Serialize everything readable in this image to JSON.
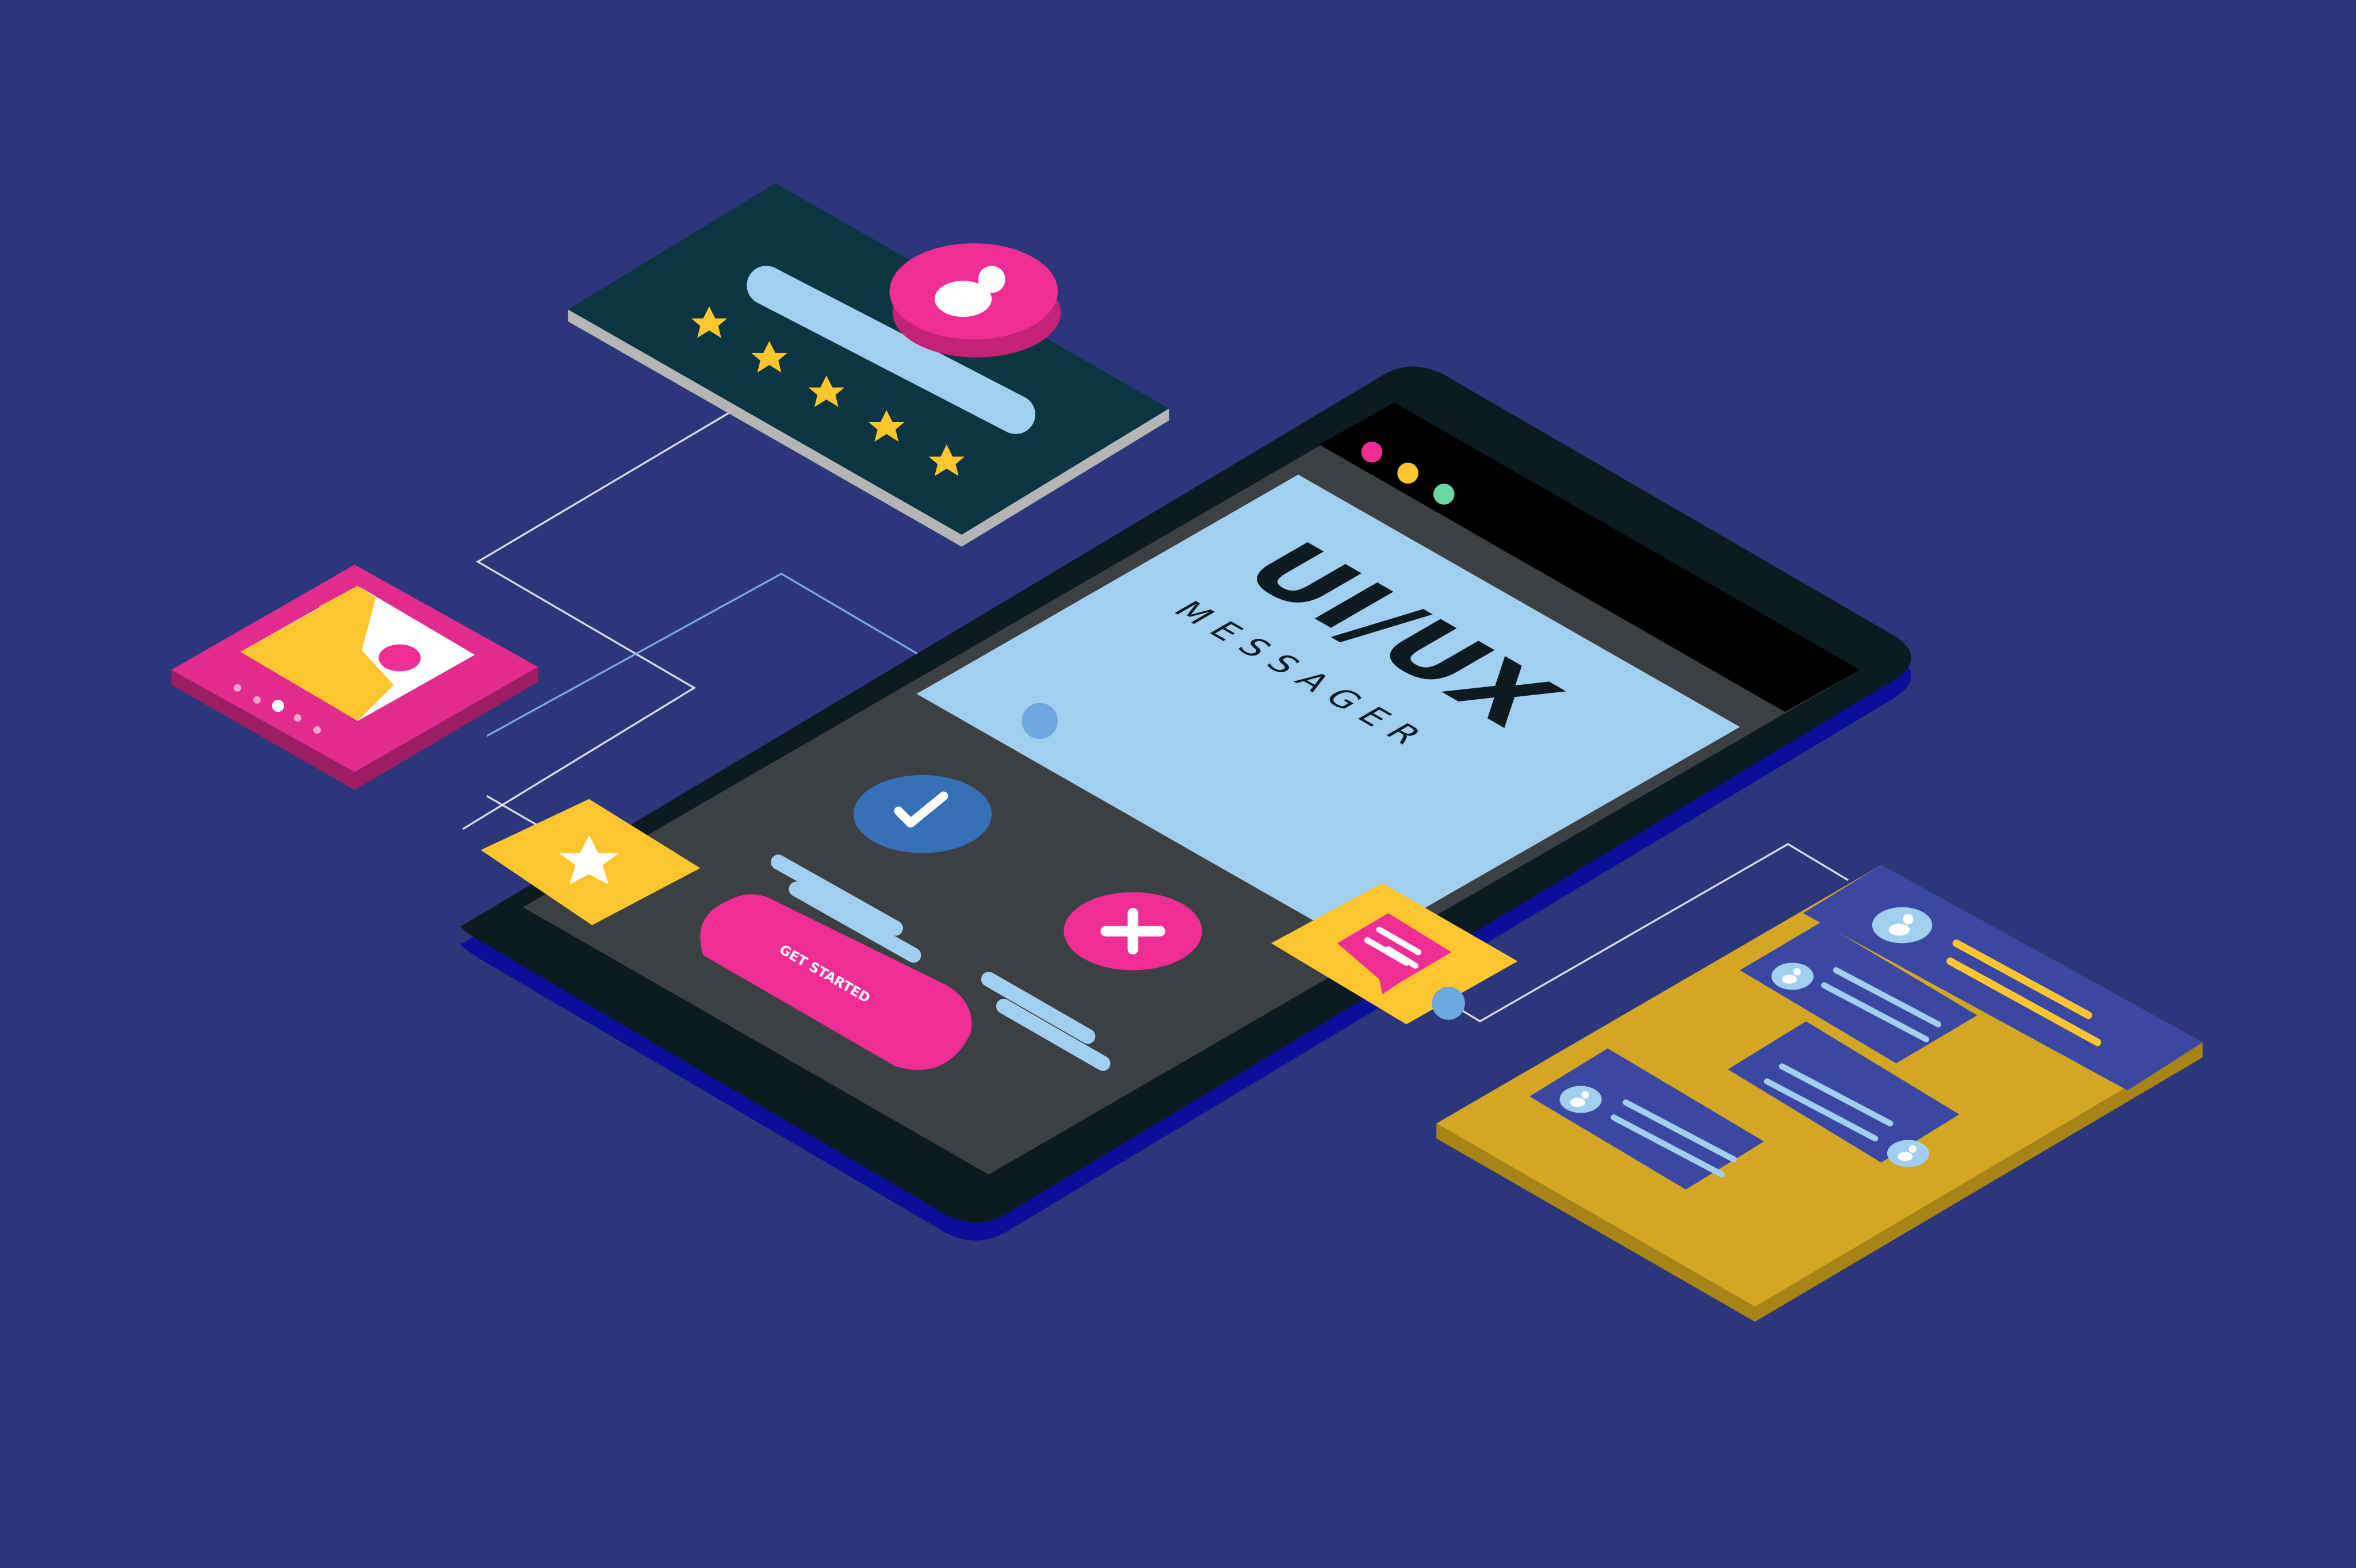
{
  "screen": {
    "title": "UI/UX",
    "subtitle": "MESSAGER"
  },
  "buttons": {
    "get_started": "GET STARTED"
  },
  "rating_card": {
    "stars": 5
  },
  "window_controls": {
    "dots": [
      "red",
      "yellow",
      "green"
    ]
  },
  "colors": {
    "background": "#2b377a",
    "phone_body": "#0c1b22",
    "phone_screen": "#3c4043",
    "screen_panel": "#a2cff0",
    "accent_pink": "#ee2e94",
    "accent_yellow": "#fdc62e",
    "accent_blue": "#3670b7",
    "card_dark": "#0b3540",
    "card_gold": "#d3a724",
    "card_indigo": "#3a48a3",
    "line_light": "#a2cff0"
  },
  "icons": {
    "check": "check-icon",
    "plus": "plus-icon",
    "star": "star-icon",
    "user": "user-icon",
    "image": "image-icon",
    "chat": "chat-bubble-icon"
  }
}
